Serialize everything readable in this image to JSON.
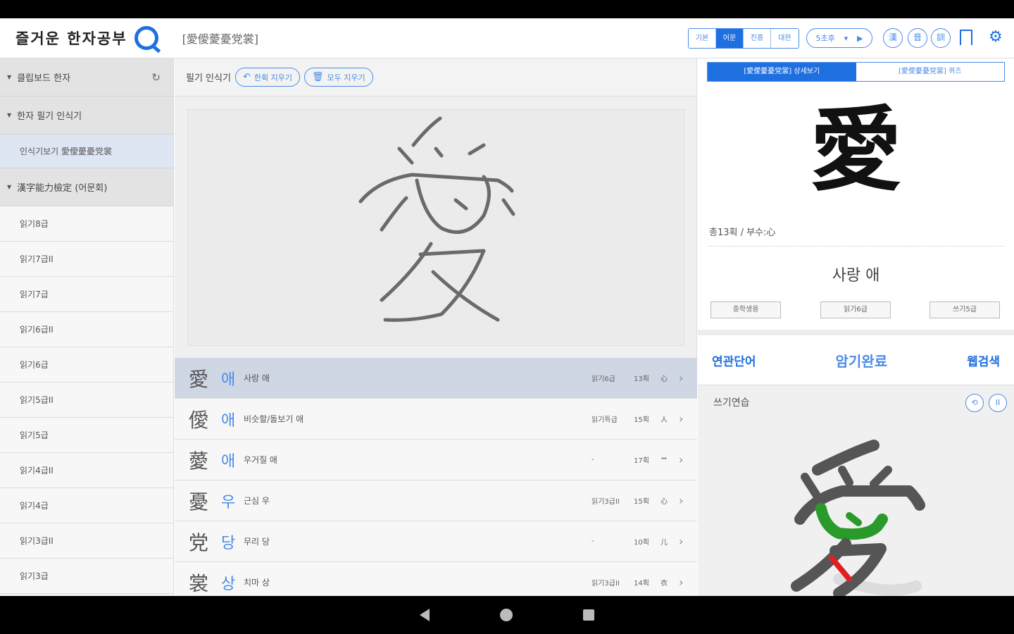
{
  "app": {
    "logo_text": "즐거운 한자공부",
    "top_chars": "[愛僾薆憂党裳]",
    "modes": [
      "기본",
      "어문",
      "진흥",
      "대한"
    ],
    "speed_label": "5초후",
    "circle_buttons": [
      "漢",
      "音",
      "訓"
    ]
  },
  "sidebar": {
    "clipboard": "클립보드 한자",
    "recognizer": "한자 필기 인식기",
    "recognizer_sub": "인식기보기 愛僾薆憂党裳",
    "exam": "漢字能力檢定 (어문회)",
    "levels": [
      "읽기8급",
      "읽기7급II",
      "읽기7급",
      "읽기6급II",
      "읽기6급",
      "읽기5급II",
      "읽기5급",
      "읽기4급II",
      "읽기4급",
      "읽기3급II",
      "읽기3급"
    ]
  },
  "middle": {
    "toolbar_label": "필기 인식기",
    "undo_label": "한획 지우기",
    "clear_label": "모두 지우기",
    "results": [
      {
        "hanja": "愛",
        "reading": "애",
        "meaning": "사랑 애",
        "grade": "읽기6급",
        "strokes": "13획",
        "radical": "心"
      },
      {
        "hanja": "僾",
        "reading": "애",
        "meaning": "비슷할/돌보기 애",
        "grade": "읽기특급",
        "strokes": "15획",
        "radical": "人"
      },
      {
        "hanja": "薆",
        "reading": "애",
        "meaning": "우거질 애",
        "grade": "-",
        "strokes": "17획",
        "radical": "艹"
      },
      {
        "hanja": "憂",
        "reading": "우",
        "meaning": "근심 우",
        "grade": "읽기3급II",
        "strokes": "15획",
        "radical": "心"
      },
      {
        "hanja": "党",
        "reading": "당",
        "meaning": "무리 당",
        "grade": "-",
        "strokes": "10획",
        "radical": "儿"
      },
      {
        "hanja": "裳",
        "reading": "상",
        "meaning": "치마 상",
        "grade": "읽기3급II",
        "strokes": "14획",
        "radical": "衣"
      }
    ]
  },
  "right": {
    "tab_detail": "[愛僾薆憂党裳] 상세보기",
    "tab_quiz": "[愛僾薆憂党裳] 퀴즈",
    "big_char": "愛",
    "stroke_info": "총13획 / 부수:心",
    "meaning": "사랑 애",
    "badges": [
      "중학생용",
      "읽기6급",
      "쓰기5급"
    ],
    "link_related": "연관단어",
    "link_done": "암기완료",
    "link_web": "웹검색",
    "practice_label": "쓰기연습",
    "practice_char": "愛"
  }
}
